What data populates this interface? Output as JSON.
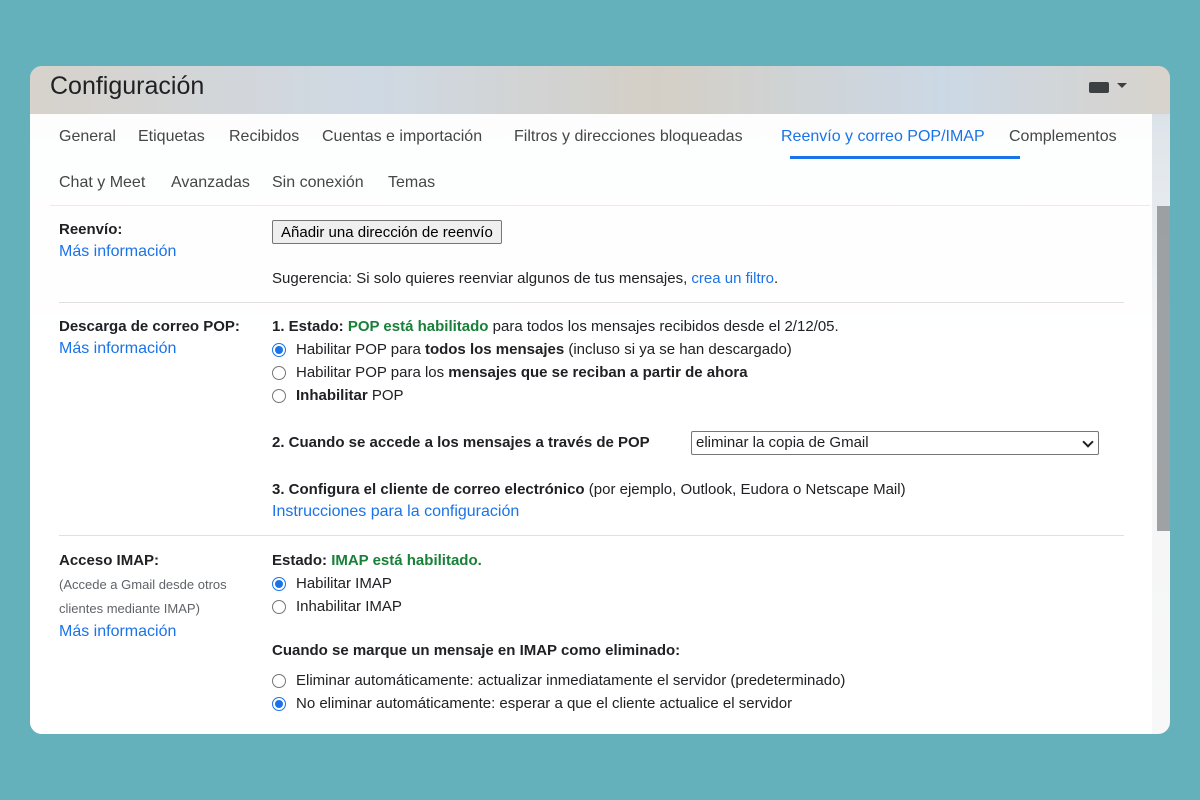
{
  "header": {
    "title": "Configuración",
    "keyboard_icon": "keyboard-icon"
  },
  "tabs": [
    {
      "label": "General"
    },
    {
      "label": "Etiquetas"
    },
    {
      "label": "Recibidos"
    },
    {
      "label": "Cuentas e importación"
    },
    {
      "label": "Filtros y direcciones bloqueadas"
    },
    {
      "label": "Reenvío y correo POP/IMAP",
      "active": true
    },
    {
      "label": "Complementos"
    },
    {
      "label": "Chat y Meet"
    },
    {
      "label": "Avanzadas"
    },
    {
      "label": "Sin conexión"
    },
    {
      "label": "Temas"
    }
  ],
  "forwarding": {
    "label": "Reenvío:",
    "more": "Más información",
    "button": "Añadir una dirección de reenvío",
    "tip_prefix": "Sugerencia: Si solo quieres reenviar algunos de tus mensajes, ",
    "tip_link": "crea un filtro",
    "tip_suffix": "."
  },
  "pop": {
    "label": "Descarga de correo POP:",
    "more": "Más información",
    "status_prefix": "1. Estado: ",
    "status_value": "POP está habilitado",
    "status_suffix": " para todos los mensajes recibidos desde el 2/12/05.",
    "options": [
      {
        "a": "Habilitar POP para ",
        "b": "todos los mensajes",
        "c": " (incluso si ya se han descargado)",
        "checked": true
      },
      {
        "a": "Habilitar POP para los ",
        "b": "mensajes que se reciban a partir de ahora",
        "c": "",
        "checked": false
      },
      {
        "a": "",
        "b": "Inhabilitar",
        "c": " POP",
        "checked": false
      }
    ],
    "access_label": "2. Cuando se accede a los mensajes a través de POP",
    "access_value": "eliminar la copia de Gmail",
    "config_label": "3. Configura el cliente de correo electrónico",
    "config_hint": " (por ejemplo, Outlook, Eudora o Netscape Mail)",
    "config_link": "Instrucciones para la configuración"
  },
  "imap": {
    "label": "Acceso IMAP:",
    "sub1": "(Accede a Gmail desde otros",
    "sub2": "clientes mediante IMAP)",
    "more": "Más información",
    "status_prefix": "Estado: ",
    "status_value": "IMAP está habilitado.",
    "options": [
      {
        "label": "Habilitar IMAP",
        "checked": true
      },
      {
        "label": "Inhabilitar IMAP",
        "checked": false
      }
    ],
    "delete_heading": "Cuando se marque un mensaje en IMAP como eliminado:",
    "delete_options": [
      {
        "label": "Eliminar automáticamente: actualizar inmediatamente el servidor (predeterminado)",
        "checked": false
      },
      {
        "label": "No eliminar automáticamente: esperar a que el cliente actualice el servidor",
        "checked": true
      }
    ]
  },
  "colors": {
    "accent": "#1a73e8",
    "enabled": "#188038",
    "background": "#64b1bb"
  }
}
